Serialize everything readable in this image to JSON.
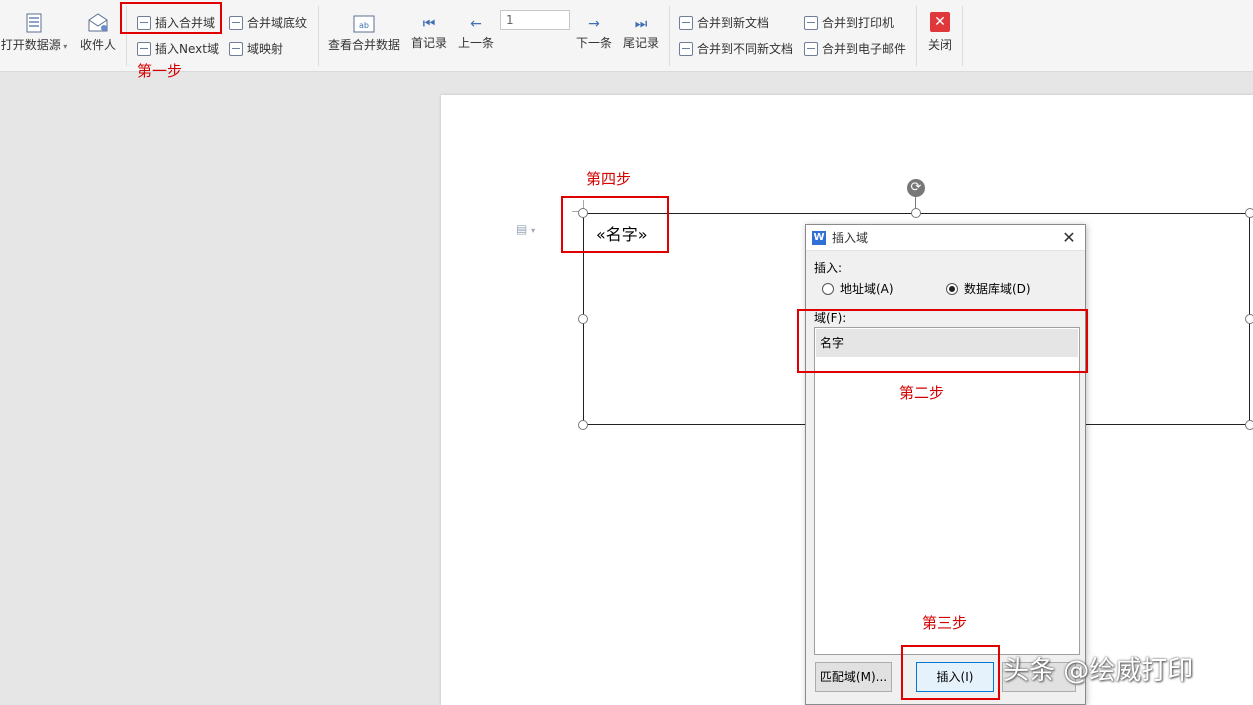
{
  "ribbon": {
    "open_data_source": "打开数据源",
    "recipients": "收件人",
    "insert_merge_field": "插入合并域",
    "insert_next_field": "插入Next域",
    "merge_field_shading": "合并域底纹",
    "field_mapping": "域映射",
    "view_merged_data": "查看合并数据",
    "first_record": "首记录",
    "previous": "上一条",
    "record_number": "1",
    "next": "下一条",
    "last_record": "尾记录",
    "merge_to_new_doc": "合并到新文档",
    "merge_to_separate_docs": "合并到不同新文档",
    "merge_to_printer": "合并到打印机",
    "merge_to_email": "合并到电子邮件",
    "close": "关闭"
  },
  "annotations": {
    "step1": "第一步",
    "step2": "第二步",
    "step3": "第三步",
    "step4": "第四步"
  },
  "document": {
    "merge_field": "«名字»"
  },
  "dialog": {
    "title": "插入域",
    "insert_label": "插入:",
    "option_address": "地址域(A)",
    "option_database": "数据库域(D)",
    "selected_option": "database",
    "field_label": "域(F):",
    "fields": [
      "名字"
    ],
    "match_fields_button": "匹配域(M)...",
    "insert_button": "插入(I)"
  },
  "watermark": "头条 @绘威打印",
  "colors": {
    "annotation_red": "#e00000",
    "close_red": "#e0373b"
  }
}
